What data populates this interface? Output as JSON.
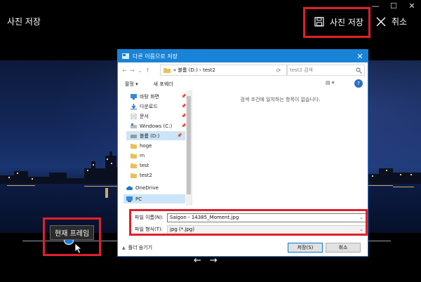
{
  "app": {
    "title": "사진 저장",
    "save_label": "사진 저장",
    "cancel_label": "취소",
    "window_controls": [
      "—",
      "☐",
      "✕"
    ]
  },
  "timeline": {
    "tooltip": "현재 프레임",
    "prev": "←",
    "next": "→"
  },
  "dialog": {
    "title": "다른 이름으로 저장",
    "close": "✕",
    "breadcrumb": "« 볼륨 (D:) › test2",
    "search_placeholder": "test2 검색",
    "toolbar": {
      "organize": "팔정 ▾",
      "new_folder": "새 포웨더"
    },
    "nav_items": [
      {
        "label": "바탕 화면",
        "icon": "desktop-icon",
        "pinned": true
      },
      {
        "label": "다운로드",
        "icon": "download-icon",
        "pinned": true
      },
      {
        "label": "문서",
        "icon": "document-icon",
        "pinned": true
      },
      {
        "label": "Windows (C:)",
        "icon": "drive-icon",
        "pinned": true
      },
      {
        "label": "볼륨 (D:)",
        "icon": "drive-icon",
        "pinned": true,
        "selected": true
      },
      {
        "label": "hoge",
        "icon": "folder-icon"
      },
      {
        "label": "rn",
        "icon": "folder-icon"
      },
      {
        "label": "test",
        "icon": "folder-icon"
      },
      {
        "label": "test2",
        "icon": "folder-icon"
      },
      {
        "label": "OneDrive",
        "icon": "cloud-icon"
      },
      {
        "label": "PC",
        "icon": "pc-icon",
        "selected": true
      }
    ],
    "empty_message": "검색 조건에 일치하는 항목이 없습니다.",
    "filename_label": "파일 이름(N):",
    "filename_value": "Saigon - 14385_Moment.jpg",
    "filetype_label": "파일 형식(T):",
    "filetype_value": "jpg (*.jpg)",
    "hide_folders": "폴더 숨기기",
    "save_button": "저장(S)",
    "cancel_button": "취소"
  },
  "colors": {
    "accent": "#1883d7",
    "highlight": "#e0202a",
    "slider": "#1e7bd8"
  }
}
